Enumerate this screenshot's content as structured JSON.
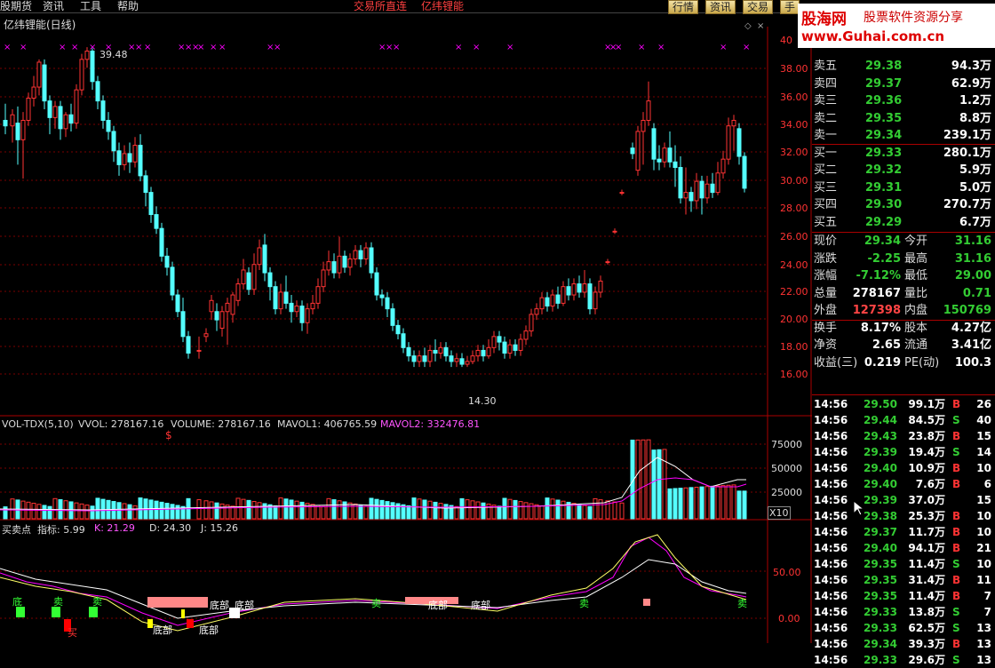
{
  "menu": {
    "items": [
      "股期货",
      "资讯",
      "工具",
      "帮助"
    ],
    "center_items": [
      "交易所直连",
      "亿纬锂能"
    ],
    "tabs": [
      "行情",
      "资讯",
      "交易",
      "手"
    ]
  },
  "chart": {
    "title": "亿纬锂能(日线)",
    "high_label": "39.48",
    "low_label": "14.30",
    "buy_marker": "$",
    "price_axis": [
      "40",
      "38.00",
      "36.00",
      "34.00",
      "32.00",
      "30.00",
      "28.00",
      "26.00",
      "24.00",
      "22.00",
      "20.00",
      "18.00",
      "16.00"
    ]
  },
  "volume": {
    "name": "VOL-TDX(5,10)",
    "vvol": "VVOL: 278167.16",
    "volume": "VOLUME: 278167.16",
    "mavol1": "MAVOL1: 406765.59",
    "mavol2": "MAVOL2: 332476.81",
    "axis": [
      "75000",
      "50000",
      "25000"
    ],
    "unit": "X10"
  },
  "indicator": {
    "name": "买卖点",
    "zhibiao": "指标: 5.99",
    "k": "K: 21.29",
    "d": "D: 24.30",
    "j": "J: 15.26",
    "axis": [
      "50.00",
      "0.00"
    ],
    "labels": [
      "底",
      "卖",
      "买",
      "底部",
      "底部",
      "底部",
      "底部",
      "卖",
      "卖",
      "卖",
      "底部",
      "底部",
      "卖"
    ]
  },
  "logo": {
    "line1": "股海网",
    "line1b": "股票软件资源分享",
    "line2": "www.Guhai.com.cn"
  },
  "quotes": {
    "orders": [
      {
        "label": "卖五",
        "price": "29.38",
        "vol": "94.3万"
      },
      {
        "label": "卖四",
        "price": "29.37",
        "vol": "62.9万"
      },
      {
        "label": "卖三",
        "price": "29.36",
        "vol": "1.2万"
      },
      {
        "label": "卖二",
        "price": "29.35",
        "vol": "8.8万"
      },
      {
        "label": "卖一",
        "price": "29.34",
        "vol": "239.1万"
      },
      {
        "label": "买一",
        "price": "29.33",
        "vol": "280.1万"
      },
      {
        "label": "买二",
        "price": "29.32",
        "vol": "5.9万"
      },
      {
        "label": "买三",
        "price": "29.31",
        "vol": "5.0万"
      },
      {
        "label": "买四",
        "price": "29.30",
        "vol": "270.7万"
      },
      {
        "label": "买五",
        "price": "29.29",
        "vol": "6.7万"
      }
    ],
    "stats": [
      {
        "l1": "现价",
        "v1": "29.34",
        "l2": "今开",
        "v2": "31.16",
        "c1": "#33cc33",
        "c2": "#33cc33"
      },
      {
        "l1": "涨跌",
        "v1": "-2.25",
        "l2": "最高",
        "v2": "31.16",
        "c1": "#33cc33",
        "c2": "#33cc33"
      },
      {
        "l1": "涨幅",
        "v1": "-7.12%",
        "l2": "最低",
        "v2": "29.00",
        "c1": "#33cc33",
        "c2": "#33cc33"
      },
      {
        "l1": "总量",
        "v1": "278167",
        "l2": "量比",
        "v2": "0.71",
        "c1": "#ffffff",
        "c2": "#33cc33"
      },
      {
        "l1": "外盘",
        "v1": "127398",
        "l2": "内盘",
        "v2": "150769",
        "c1": "#ff4444",
        "c2": "#33cc33"
      },
      {
        "l1": "换手",
        "v1": "8.17%",
        "l2": "股本",
        "v2": "4.27亿",
        "c1": "#ffffff",
        "c2": "#ffffff"
      },
      {
        "l1": "净资",
        "v1": "2.65",
        "l2": "流通",
        "v2": "3.41亿",
        "c1": "#ffffff",
        "c2": "#ffffff"
      },
      {
        "l1": "收益(三)",
        "v1": "0.219",
        "l2": "PE(动)",
        "v2": "100.3",
        "c1": "#ffffff",
        "c2": "#ffffff"
      }
    ]
  },
  "ticks": [
    {
      "t": "14:56",
      "p": "29.50",
      "v": "99.1万",
      "s": "B",
      "n": "26"
    },
    {
      "t": "14:56",
      "p": "29.44",
      "v": "84.5万",
      "s": "S",
      "n": "40"
    },
    {
      "t": "14:56",
      "p": "29.43",
      "v": "23.8万",
      "s": "B",
      "n": "15"
    },
    {
      "t": "14:56",
      "p": "29.39",
      "v": "19.4万",
      "s": "S",
      "n": "14"
    },
    {
      "t": "14:56",
      "p": "29.40",
      "v": "10.9万",
      "s": "B",
      "n": "10"
    },
    {
      "t": "14:56",
      "p": "29.40",
      "v": "7.6万",
      "s": "B",
      "n": "6"
    },
    {
      "t": "14:56",
      "p": "29.39",
      "v": "37.0万",
      "s": "",
      "n": "15"
    },
    {
      "t": "14:56",
      "p": "29.38",
      "v": "25.3万",
      "s": "B",
      "n": "10"
    },
    {
      "t": "14:56",
      "p": "29.37",
      "v": "11.7万",
      "s": "B",
      "n": "10"
    },
    {
      "t": "14:56",
      "p": "29.40",
      "v": "94.1万",
      "s": "B",
      "n": "21"
    },
    {
      "t": "14:56",
      "p": "29.35",
      "v": "11.4万",
      "s": "S",
      "n": "10"
    },
    {
      "t": "14:56",
      "p": "29.35",
      "v": "31.4万",
      "s": "B",
      "n": "11"
    },
    {
      "t": "14:56",
      "p": "29.35",
      "v": "11.4万",
      "s": "B",
      "n": "7"
    },
    {
      "t": "14:56",
      "p": "29.33",
      "v": "13.8万",
      "s": "S",
      "n": "7"
    },
    {
      "t": "14:56",
      "p": "29.33",
      "v": "62.5万",
      "s": "S",
      "n": "13"
    },
    {
      "t": "14:56",
      "p": "29.34",
      "v": "39.3万",
      "s": "B",
      "n": "13"
    },
    {
      "t": "14:56",
      "p": "29.33",
      "v": "29.6万",
      "s": "S",
      "n": "13"
    }
  ],
  "colors": {
    "up": "#ff3333",
    "down": "#54ffff",
    "grid": "#7a0000",
    "magenta": "#ff00ff"
  }
}
